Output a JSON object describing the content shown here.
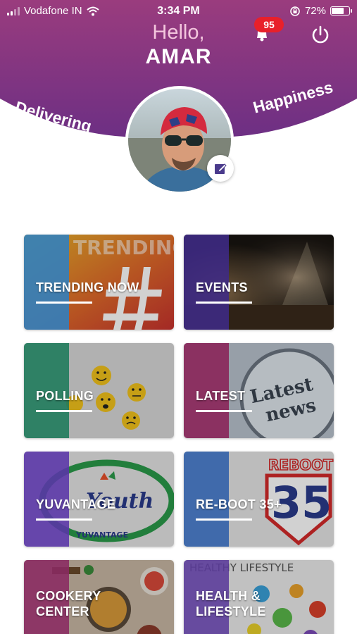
{
  "status_bar": {
    "carrier": "Vodafone IN",
    "time": "3:34 PM",
    "battery_percent": "72%",
    "battery_level": 0.72,
    "icons": [
      "signal-icon",
      "wifi-icon",
      "orientation-lock-icon",
      "battery-icon"
    ]
  },
  "header": {
    "greeting": "Hello,",
    "username": "AMAR",
    "tagline_left": "Delivering",
    "tagline_right": "Happiness",
    "notification_count": "95",
    "gradient_top": "#9a3c7e",
    "gradient_bottom": "#5a2a86"
  },
  "tiles": [
    {
      "label": "TRENDING NOW",
      "band": "#2f7fc0",
      "art": "trending"
    },
    {
      "label": "EVENTS",
      "band": "#3f2a86",
      "art": "events"
    },
    {
      "label": "POLLING",
      "band": "#1d7a5a",
      "art": "polling"
    },
    {
      "label": "LATEST",
      "band": "#8a2256",
      "art": "latest"
    },
    {
      "label": "YUVANTAGE",
      "band": "#5a36a8",
      "art": "yuvantage"
    },
    {
      "label": "RE-BOOT 35+",
      "band": "#2f5fa8",
      "art": "reboot"
    },
    {
      "label": "COOKERY\nCENTER",
      "band": "#8a2a62",
      "art": "cookery"
    },
    {
      "label": "HEALTH &\nLIFESTYLE",
      "band": "#5a3a9a",
      "art": "health"
    }
  ],
  "tile_art_text": {
    "trending": "TRENDING NOW",
    "latest_1": "Latest",
    "latest_2": "news",
    "yuvantage_1": "Youth",
    "yuvantage_2": "YUVANTAGE",
    "reboot": "REBOOT",
    "health": "HEALTHY LIFESTYLE"
  }
}
